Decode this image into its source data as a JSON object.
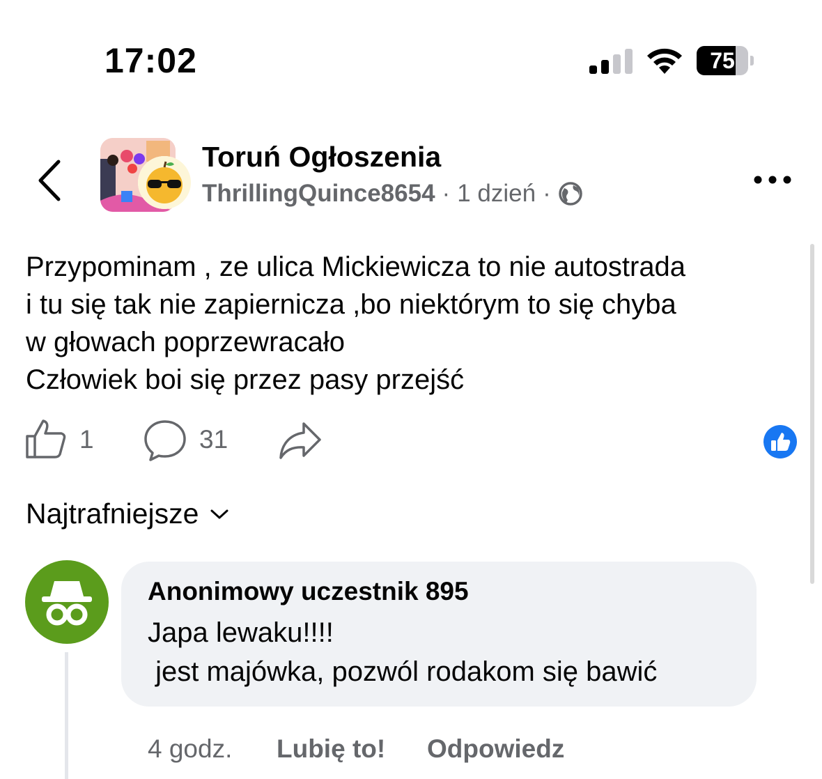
{
  "status_bar": {
    "time": "17:02",
    "battery_level": "75",
    "battery_fraction": 0.75
  },
  "header": {
    "group_name": "Toruń Ogłoszenia",
    "author": "ThrillingQuince8654",
    "separator": "·",
    "time_ago": "1 dzień",
    "privacy_icon": "globe-icon"
  },
  "post": {
    "text": "Przypominam , ze ulica Mickiewicza to nie autostrada\ni tu się tak nie zapiernicza ,bo niektórym to się chyba\nw głowach poprzewracało\nCzłowiek boi się przez pasy przejść"
  },
  "actions": {
    "like_count": "1",
    "comment_count": "31",
    "icons": [
      "thumbs-up-icon",
      "comment-icon",
      "share-icon"
    ]
  },
  "sort": {
    "label": "Najtrafniejsze"
  },
  "comment": {
    "author": "Anonimowy uczestnik 895",
    "text": "Japa lewaku!!!!\n jest majówka, pozwól rodakom się bawić",
    "time": "4 godz.",
    "like_label": "Lubię to!",
    "reply_label": "Odpowiedz"
  },
  "colors": {
    "accent_blue": "#1877f2",
    "anon_green": "#5b9c1c",
    "secondary_text": "#65676b",
    "bubble_bg": "#f0f2f5"
  }
}
